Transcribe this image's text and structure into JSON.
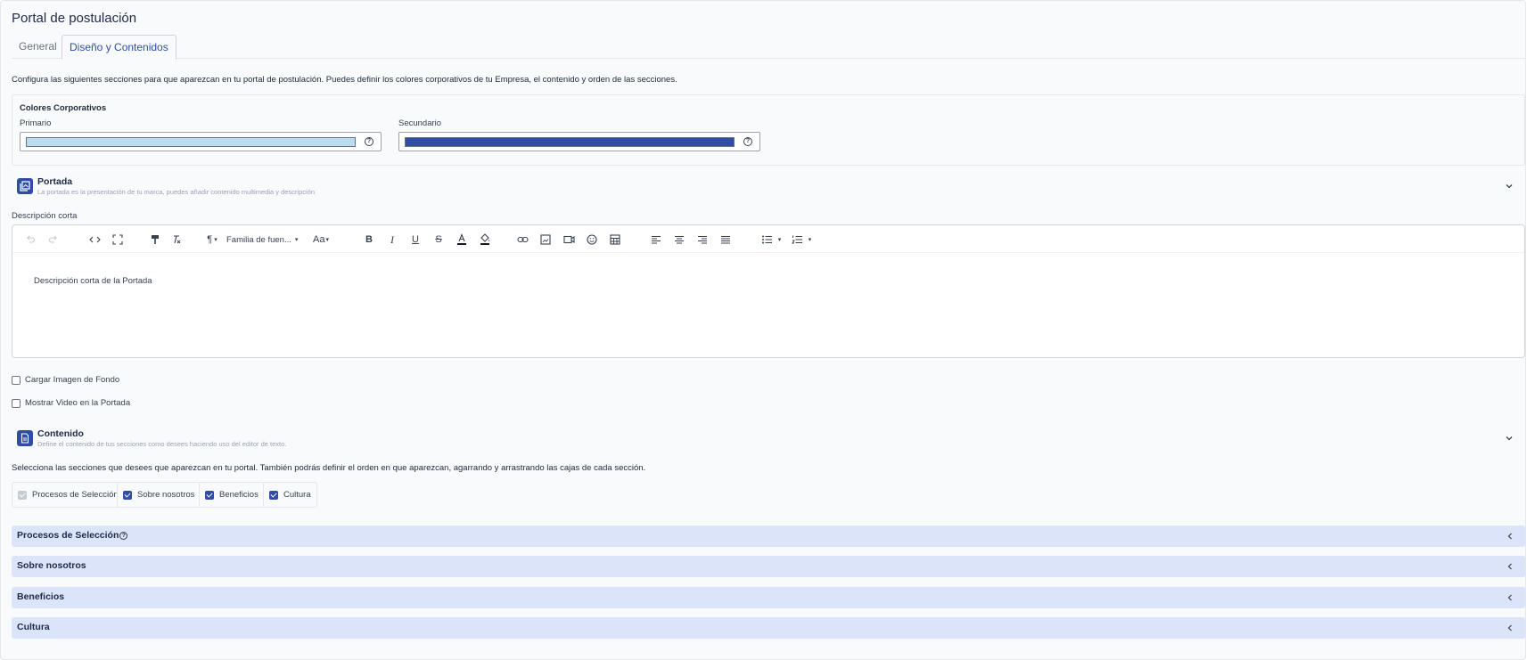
{
  "header": {
    "title": "Portal de postulación"
  },
  "tabs": [
    {
      "label": "General",
      "active": false
    },
    {
      "label": "Diseño y Contenidos",
      "active": true
    }
  ],
  "intro": "Configura las siguientes secciones para que aparezcan en tu portal de postulación. Puedes definir los colores corporativos de tu Empresa, el contenido y orden de las secciones.",
  "colors": {
    "title": "Colores Corporativos",
    "primary": {
      "label": "Primario",
      "value": "#b9dcf0"
    },
    "secondary": {
      "label": "Secundario",
      "value": "#2f4da6"
    }
  },
  "portada": {
    "title": "Portada",
    "subtitle": "La portada es la presentación de tu marca, puedes añadir contenido multimedia y descripción",
    "short_desc_label": "Descripción corta",
    "editor_text": "Descripción corta de la Portada",
    "toolbar": {
      "font_family": "Familia de fuen...",
      "font_size": "Aa"
    },
    "checkboxes": [
      {
        "label": "Cargar Imagen de Fondo",
        "checked": false
      },
      {
        "label": "Mostrar Video en la Portada",
        "checked": false
      }
    ]
  },
  "contenido": {
    "title": "Contenido",
    "subtitle": "Define el contenido de tus secciones como desees haciendo uso del editor de texto.",
    "select_intro": "Selecciona las secciones que desees que aparezcan en tu portal. También podrás definir el orden en que aparezcan, agarrando y arrastrando las cajas de cada sección.",
    "chips": [
      {
        "label": "Procesos de Selección",
        "checked": true,
        "disabled": true
      },
      {
        "label": "Sobre nosotros",
        "checked": true,
        "disabled": false
      },
      {
        "label": "Beneficios",
        "checked": true,
        "disabled": false
      },
      {
        "label": "Cultura",
        "checked": true,
        "disabled": false
      }
    ],
    "accordions": [
      {
        "label": "Procesos de Selección"
      },
      {
        "label": "Sobre nosotros"
      },
      {
        "label": "Beneficios"
      },
      {
        "label": "Cultura"
      }
    ]
  },
  "theme": {
    "accent": "#2f4da6",
    "accordion_bg": "#dbe4f8"
  }
}
